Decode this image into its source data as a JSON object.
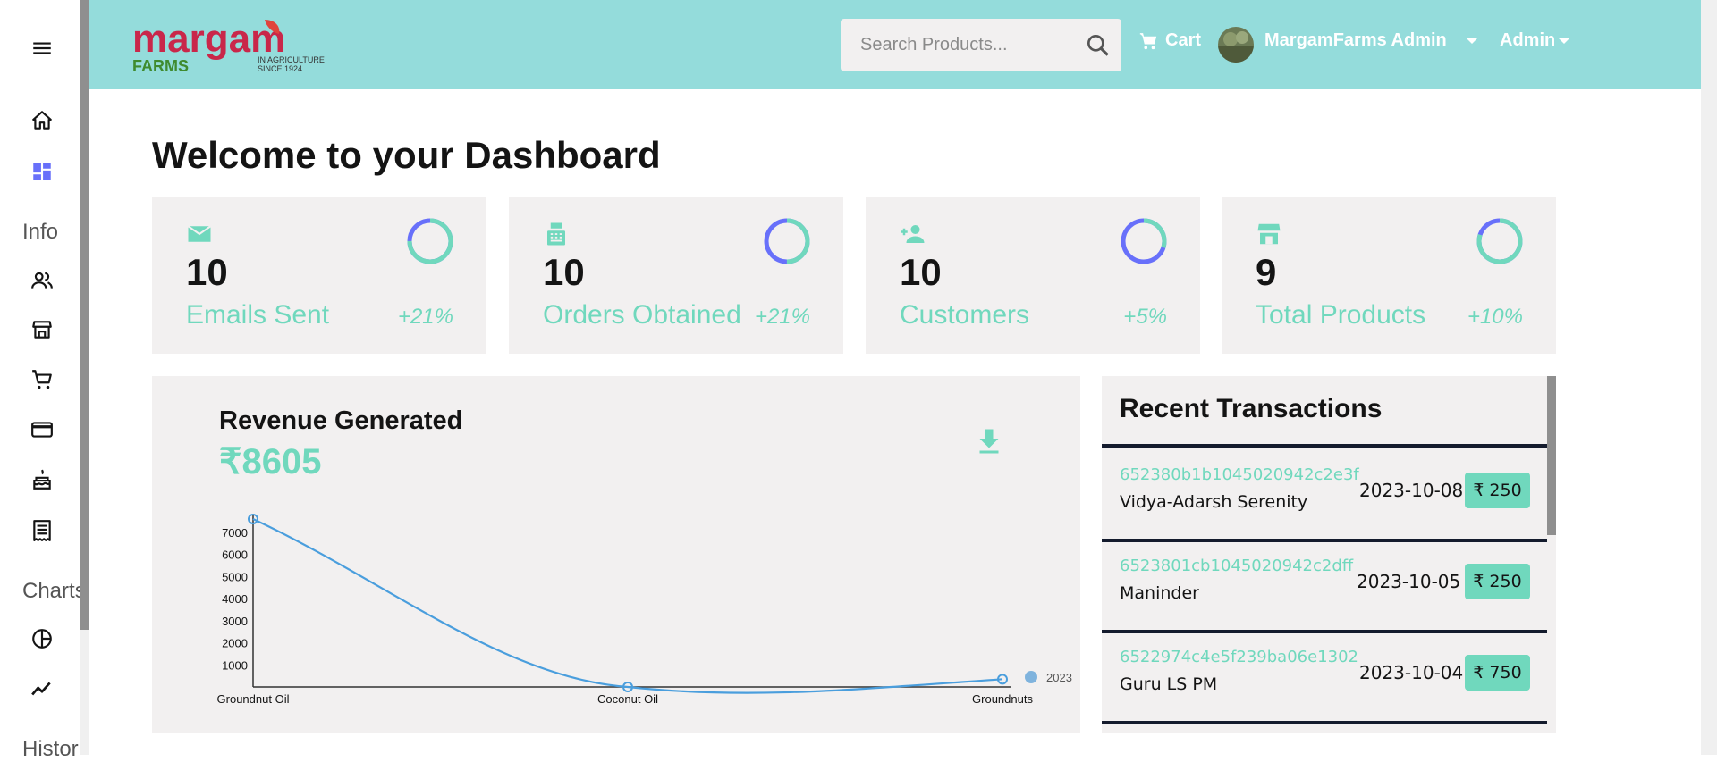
{
  "sidebar": {
    "sections": {
      "info": "Info",
      "charts": "Charts",
      "history": "Histor"
    },
    "icons": [
      "menu-icon",
      "home-icon",
      "dashboard-icon",
      "contacts-icon",
      "store-icon",
      "cart-icon",
      "card-icon",
      "cake-icon",
      "receipt-icon",
      "pie-chart-icon",
      "line-chart-icon"
    ]
  },
  "brand": {
    "name": "margam",
    "sub": "FARMS",
    "tagline1": "IN AGRICULTURE",
    "tagline2": "SINCE 1924"
  },
  "header": {
    "search_placeholder": "Search Products...",
    "cart_label": "Cart",
    "user_name": "MargamFarms Admin",
    "role_label": "Admin"
  },
  "dashboard": {
    "title": "Welcome to your Dashboard"
  },
  "stats": [
    {
      "value": "10",
      "label": "Emails Sent",
      "delta": "+21%",
      "icon": "email-icon",
      "progress": 0.75
    },
    {
      "value": "10",
      "label": "Orders Obtained",
      "delta": "+21%",
      "icon": "point-of-sale-icon",
      "progress": 0.5
    },
    {
      "value": "10",
      "label": "Customers",
      "delta": "+5%",
      "icon": "person-add-icon",
      "progress": 0.3
    },
    {
      "value": "9",
      "label": "Total Products",
      "delta": "+10%",
      "icon": "storefront-icon",
      "progress": 0.8
    }
  ],
  "revenue": {
    "title": "Revenue Generated",
    "value": "₹8605"
  },
  "chart_data": {
    "type": "line",
    "categories": [
      "Groundnut Oil",
      "Coconut Oil",
      "Groundnuts"
    ],
    "series": [
      {
        "name": "2023",
        "values": [
          7600,
          0,
          350
        ]
      }
    ],
    "yticks": [
      1000,
      2000,
      3000,
      4000,
      5000,
      6000,
      7000
    ],
    "ylim": [
      0,
      7800
    ],
    "legend": "right",
    "color": "#4a9edd"
  },
  "transactions": {
    "title": "Recent Transactions",
    "items": [
      {
        "id": "652380b1b1045020942c2e3f",
        "user": "Vidya-Adarsh Serenity",
        "date": "2023-10-08",
        "cost": "₹ 250"
      },
      {
        "id": "6523801cb1045020942c2dff",
        "user": "Maninder",
        "date": "2023-10-05",
        "cost": "₹ 250"
      },
      {
        "id": "6522974c4e5f239ba06e1302",
        "user": "Guru LS PM",
        "date": "2023-10-04",
        "cost": "₹ 750"
      }
    ]
  },
  "colors": {
    "accent": "#70d8bd",
    "topbar": "#94dcdb",
    "card": "#f2f0f0",
    "ring_primary": "#6870fa"
  }
}
